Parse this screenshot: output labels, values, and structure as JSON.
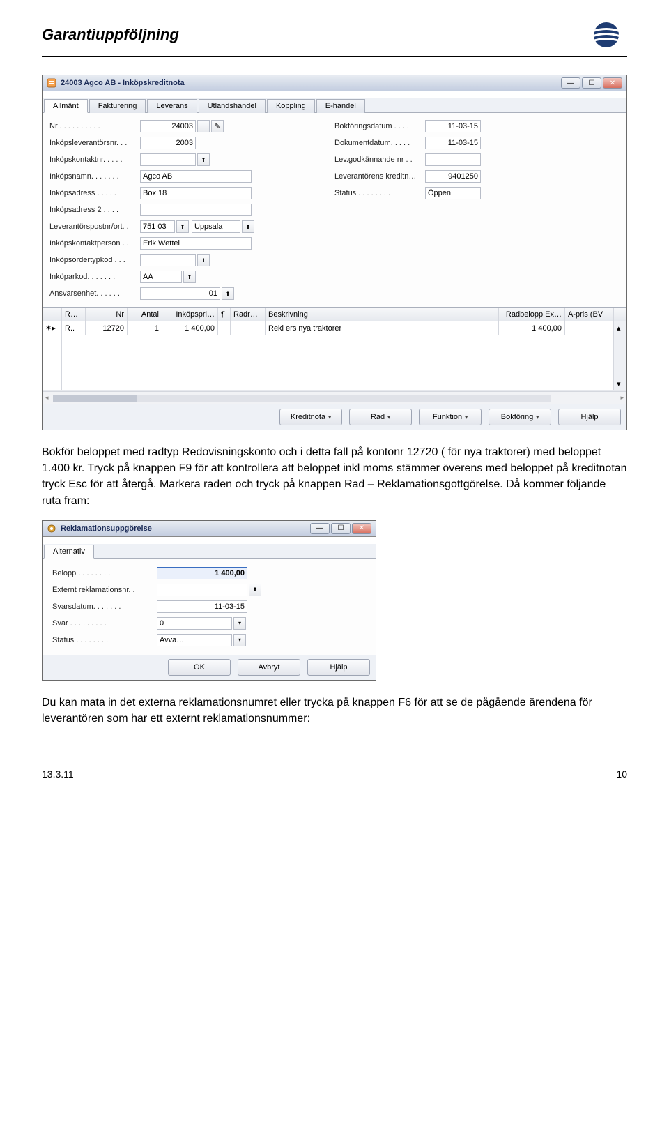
{
  "header": {
    "title": "Garantiuppföljning"
  },
  "window1": {
    "title": "24003 Agco AB - Inköpskreditnota",
    "tabs": [
      "Allmänt",
      "Fakturering",
      "Leverans",
      "Utlandshandel",
      "Koppling",
      "E-handel"
    ],
    "left": {
      "nr_label": "Nr  . . . . . . . . . .",
      "nr_value": "24003",
      "inklev_label": "Inköpsleverantörsnr. . .",
      "inklev_value": "2003",
      "inkkontakt_label": "Inköpskontaktnr. . . . .",
      "inkkontakt_value": "",
      "inknamn_label": "Inköpsnamn. . . . . . .",
      "inknamn_value": "Agco AB",
      "inkadr_label": "Inköpsadress . . . . .",
      "inkadr_value": "Box 18",
      "inkadr2_label": "Inköpsadress 2 . . . .",
      "inkadr2_value": "",
      "levpost_label": "Leverantörspostnr/ort. .",
      "levpost_value": "751 03",
      "levort_value": "Uppsala",
      "inkperson_label": "Inköpskontaktperson . .",
      "inkperson_value": "Erik Wettel",
      "inkorder_label": "Inköpsordertypkod . . .",
      "inkorder_value": "",
      "inkopark_label": "Inköparkod. . . . . . .",
      "inkopark_value": "AA",
      "ansvar_label": "Ansvarsenhet. . . . . .",
      "ansvar_value": "01"
    },
    "right": {
      "bokdat_label": "Bokföringsdatum . . . .",
      "bokdat_value": "11-03-15",
      "dokdat_label": "Dokumentdatum. . . . .",
      "dokdat_value": "11-03-15",
      "levgodk_label": "Lev.godkännande nr  . .",
      "levgodk_value": "",
      "levkred_label": "Leverantörens kreditn…",
      "levkred_value": "9401250",
      "status_label": "Status . . . . . . . .",
      "status_value": "Öppen"
    },
    "grid": {
      "headers": [
        "R…",
        "Nr",
        "Antal",
        "Inköpspri…",
        "¶",
        "Radr…",
        "Beskrivning",
        "Radbelopp Ex…",
        "A-pris (BV"
      ],
      "row": {
        "rtype": "R..",
        "nr": "12720",
        "antal": "1",
        "pris": "1 400,00",
        "radr": "",
        "beskr": "Rekl ers nya traktorer",
        "radbel": "1 400,00"
      }
    },
    "buttons": [
      "Kreditnota",
      "Rad",
      "Funktion",
      "Bokföring",
      "Hjälp"
    ]
  },
  "para1": "Bokför beloppet med radtyp Redovisningskonto och i detta fall på kontonr 12720 ( för nya traktorer) med beloppet 1.400 kr. Tryck på knappen F9 för att kontrollera att beloppet inkl moms stämmer överens med beloppet på kreditnotan tryck Esc för att återgå. Markera raden och tryck på knappen Rad – Reklamationsgottgörelse. Då kommer följande ruta fram:",
  "window2": {
    "title": "Reklamationsuppgörelse",
    "tab": "Alternativ",
    "fields": {
      "belopp_label": "Belopp . . . . . . . .",
      "belopp_value": "1 400,00",
      "ext_label": "Externt reklamationsnr. .",
      "ext_value": "",
      "svarsdat_label": "Svarsdatum. . . . . . .",
      "svarsdat_value": "11-03-15",
      "svar_label": "Svar . . . . . . . . .",
      "svar_value": "0",
      "status_label": "Status . . . . . . . .",
      "status_value": "Avva…"
    },
    "buttons": {
      "ok": "OK",
      "avbryt": "Avbryt",
      "hjalp": "Hjälp"
    }
  },
  "para2": "Du kan mata in det externa reklamationsnumret eller trycka på knappen F6 för att se de pågående ärendena för leverantören som har ett externt reklamationsnummer:",
  "footer": {
    "date": "13.3.11",
    "page": "10"
  }
}
